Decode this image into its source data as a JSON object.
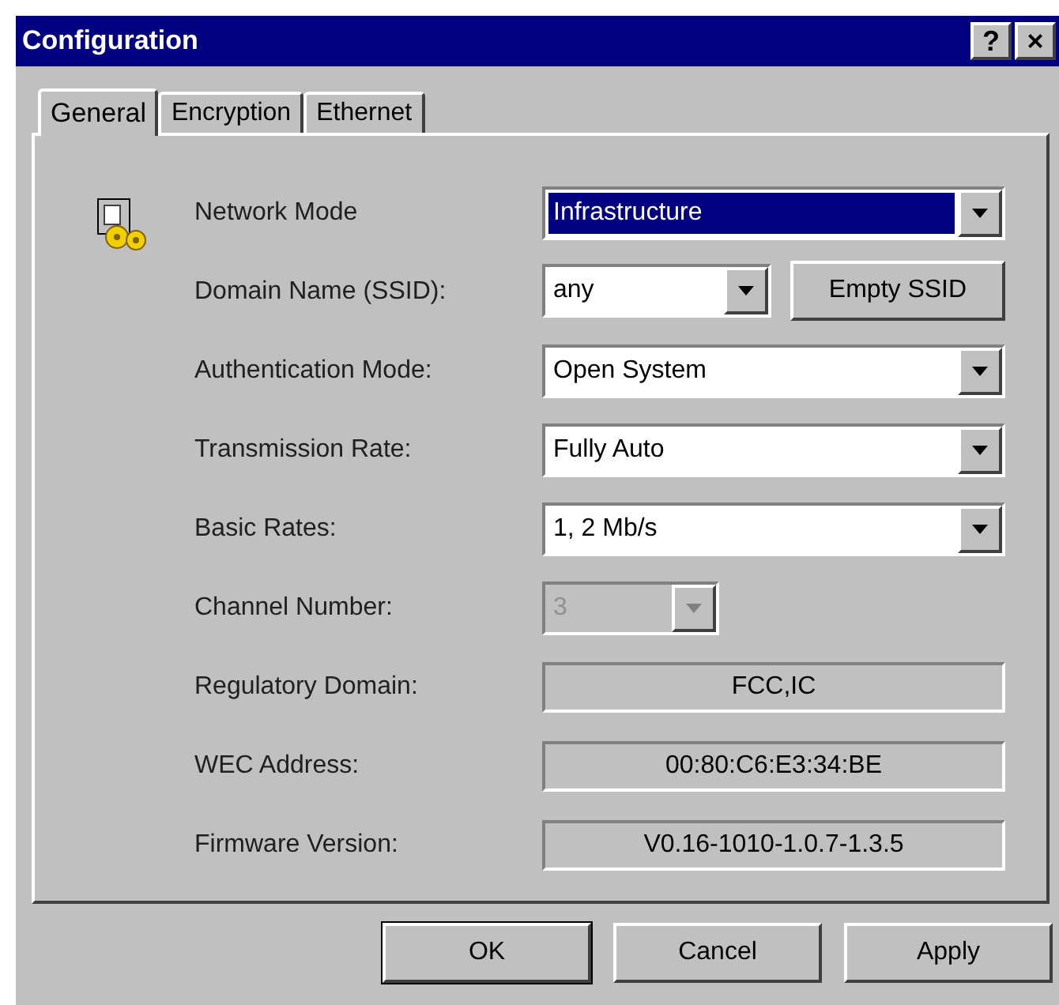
{
  "window": {
    "title": "Configuration",
    "title_buttons": [
      "?",
      "×"
    ]
  },
  "tabs": [
    {
      "label": "General",
      "selected": true
    },
    {
      "label": "Encryption",
      "selected": false
    },
    {
      "label": "Ethernet",
      "selected": false
    }
  ],
  "rows": [
    {
      "label": "Network Mode",
      "kind": "combo",
      "value": "Infrastructure",
      "focused": true,
      "disabled": false
    },
    {
      "label": "Domain Name (SSID):",
      "kind": "combo_button",
      "value": "any",
      "button": "Empty SSID",
      "focused": false,
      "disabled": false
    },
    {
      "label": "Authentication Mode:",
      "kind": "combo",
      "value": "Open System",
      "focused": false,
      "disabled": false
    },
    {
      "label": "Transmission Rate:",
      "kind": "combo",
      "value": "Fully Auto",
      "focused": false,
      "disabled": false
    },
    {
      "label": "Basic Rates:",
      "kind": "combo",
      "value": "1, 2 Mb/s",
      "focused": false,
      "disabled": false
    },
    {
      "label": "Channel Number:",
      "kind": "small_combo",
      "value": "3",
      "focused": false,
      "disabled": true
    },
    {
      "label": "Regulatory Domain:",
      "kind": "readonly",
      "value": "FCC,IC"
    },
    {
      "label": "WEC Address:",
      "kind": "readonly",
      "value": "00:80:C6:E3:34:BE"
    },
    {
      "label": "Firmware Version:",
      "kind": "readonly",
      "value": "V0.16-1010-1.0.7-1.3.5"
    }
  ],
  "buttons": [
    "OK",
    "Cancel",
    "Apply"
  ]
}
